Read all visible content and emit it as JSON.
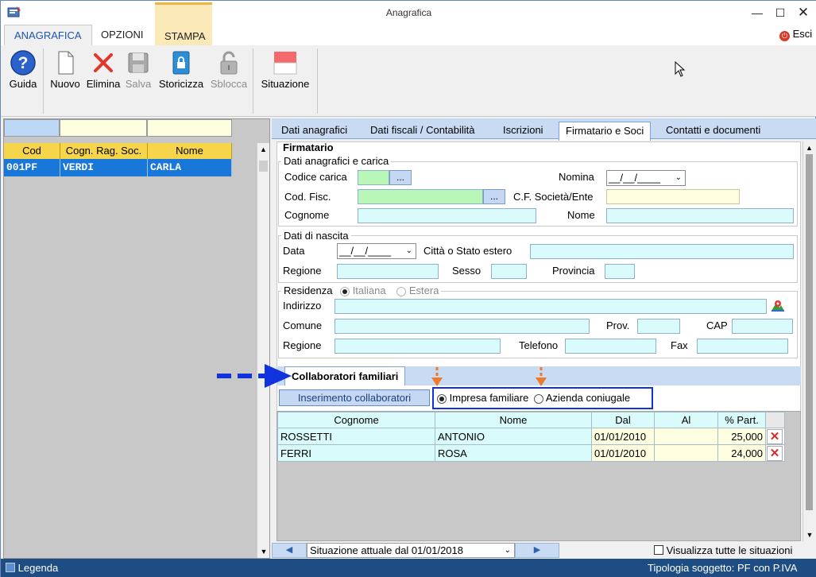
{
  "window": {
    "title": "Anagrafica",
    "exit_label": "Esci"
  },
  "ribbon": {
    "tabs": [
      {
        "label": "ANAGRAFICA"
      },
      {
        "label": "OPZIONI"
      },
      {
        "label": "STAMPA"
      }
    ]
  },
  "toolbar": {
    "guida": "Guida",
    "nuovo": "Nuovo",
    "elimina": "Elimina",
    "salva": "Salva",
    "storicizza": "Storicizza",
    "sblocca": "Sblocca",
    "situazione": "Situazione"
  },
  "list": {
    "columns": [
      "Cod",
      "Cogn. Rag. Soc.",
      "Nome"
    ],
    "rows": [
      {
        "cod": "001PF",
        "cognome": "VERDI",
        "nome": "CARLA"
      }
    ]
  },
  "detail_tabs": [
    {
      "label": "Dati anagrafici"
    },
    {
      "label": "Dati fiscali / Contabilità"
    },
    {
      "label": "Iscrizioni"
    },
    {
      "label": "Firmatario e Soci"
    },
    {
      "label": "Contatti e documenti"
    }
  ],
  "firmatario": {
    "section_title": "Firmatario",
    "group_anagrafici": "Dati anagrafici e carica",
    "codice_carica": "Codice carica",
    "nomina": "Nomina",
    "nomina_value": "__/__/____",
    "cod_fisc": "Cod. Fisc.",
    "cf_societa": "C.F. Società/Ente",
    "cognome": "Cognome",
    "nome": "Nome",
    "dots": "...",
    "group_nascita": "Dati di nascita",
    "data": "Data",
    "data_value": "__/__/____",
    "citta_estero": "Città o Stato estero",
    "regione": "Regione",
    "sesso": "Sesso",
    "provincia": "Provincia",
    "group_residenza": "Residenza",
    "italiana": "Italiana",
    "estera": "Estera",
    "indirizzo": "Indirizzo",
    "comune": "Comune",
    "prov": "Prov.",
    "cap": "CAP",
    "regione2": "Regione",
    "telefono": "Telefono",
    "fax": "Fax"
  },
  "collaboratori": {
    "tab_label": "Collaboratori familiari",
    "insert_button": "Inserimento collaboratori",
    "radio_impresa": "Impresa familiare",
    "radio_azienda": "Azienda coniugale",
    "columns": [
      "Cognome",
      "Nome",
      "Dal",
      "Al",
      "% Part."
    ],
    "rows": [
      {
        "cognome": "ROSSETTI",
        "nome": "ANTONIO",
        "dal": "01/01/2010",
        "al": "",
        "part": "25,000"
      },
      {
        "cognome": "FERRI",
        "nome": "ROSA",
        "dal": "01/01/2010",
        "al": "",
        "part": "24,000"
      }
    ]
  },
  "situazione": {
    "selected": "Situazione attuale dal 01/01/2018",
    "show_all": "Visualizza tutte le situazioni"
  },
  "status": {
    "legenda": "Legenda",
    "tipologia": "Tipologia soggetto: PF con P.IVA"
  },
  "colors": {
    "accent_blue": "#1f55a8",
    "annotation_blue": "#1133dd",
    "annotation_orange": "#f07a2a",
    "selection_blue": "#1877d8",
    "status_bar": "#1d4d82"
  }
}
